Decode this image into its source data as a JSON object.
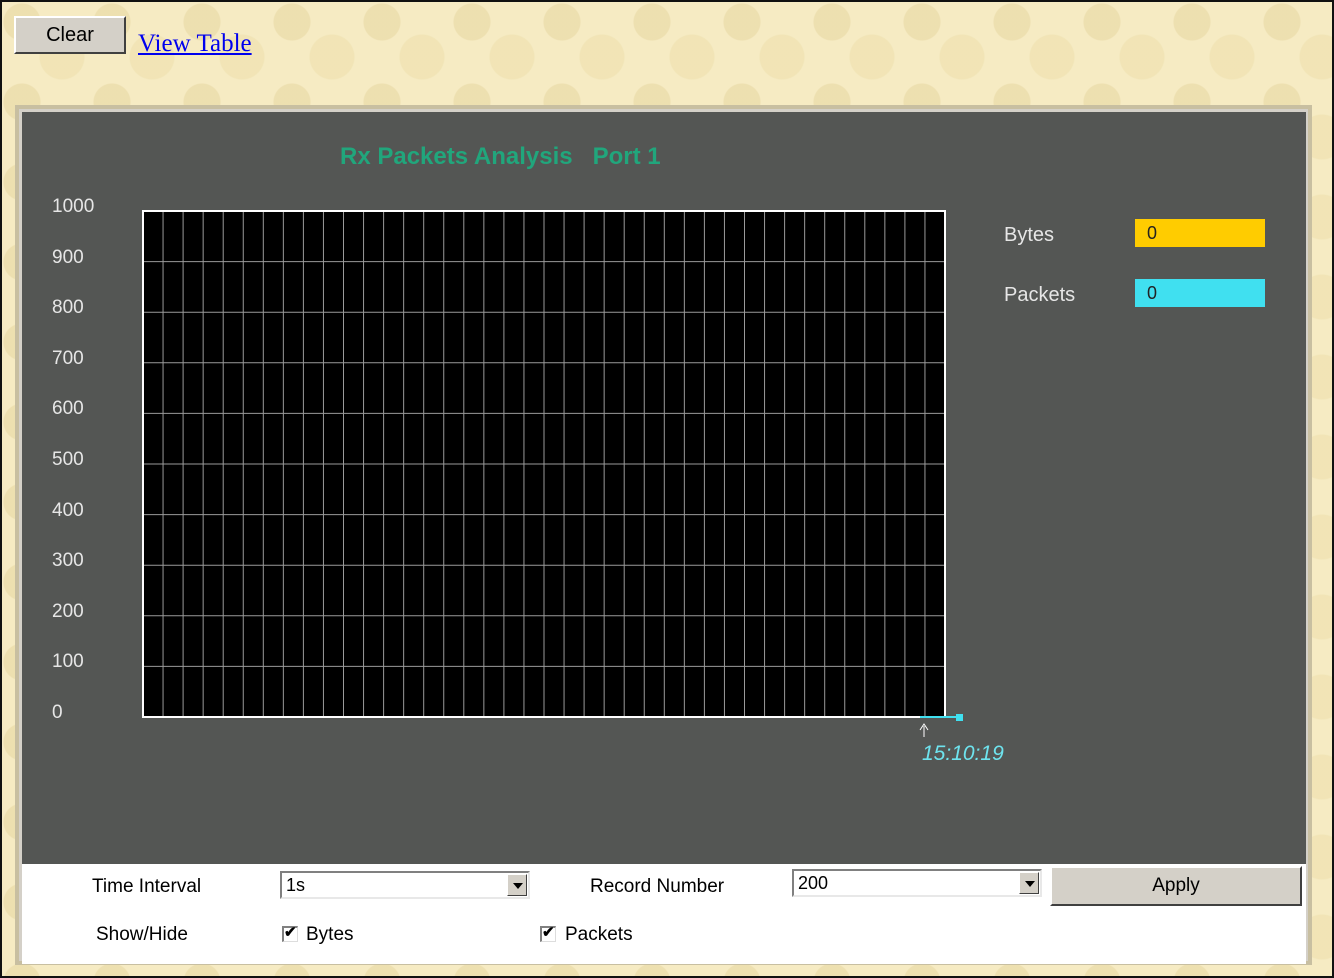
{
  "toolbar": {
    "clear_label": "Clear",
    "view_table_label": "View Table"
  },
  "chart_data": {
    "type": "line",
    "title": "Rx Packets Analysis   Port 1",
    "ylim": [
      0,
      1000
    ],
    "y_ticks": [
      "1000",
      "900",
      "800",
      "700",
      "600",
      "500",
      "400",
      "300",
      "200",
      "100",
      "0"
    ],
    "x_tick_labels": [
      "15:10:19"
    ],
    "grid": true,
    "legend_position": "right",
    "series": [
      {
        "name": "Bytes",
        "values": [
          0
        ],
        "color": "#ffcc00"
      },
      {
        "name": "Packets",
        "values": [
          0
        ],
        "color": "#40e0f0"
      }
    ]
  },
  "legend": {
    "items": [
      {
        "label": "Bytes",
        "value": "0",
        "color": "#ffcc00"
      },
      {
        "label": "Packets",
        "value": "0",
        "color": "#40e0f0"
      }
    ]
  },
  "controls": {
    "time_interval_label": "Time Interval",
    "time_interval_value": "1s",
    "record_number_label": "Record Number",
    "record_number_value": "200",
    "apply_label": "Apply",
    "show_hide_label": "Show/Hide",
    "bytes_checkbox_label": "Bytes",
    "bytes_checked": true,
    "packets_checkbox_label": "Packets",
    "packets_checked": true
  },
  "colors": {
    "chart_background": "#545654",
    "plot_background": "#000000",
    "title_color": "#21a67c",
    "time_label_color": "#6ee3ee"
  }
}
